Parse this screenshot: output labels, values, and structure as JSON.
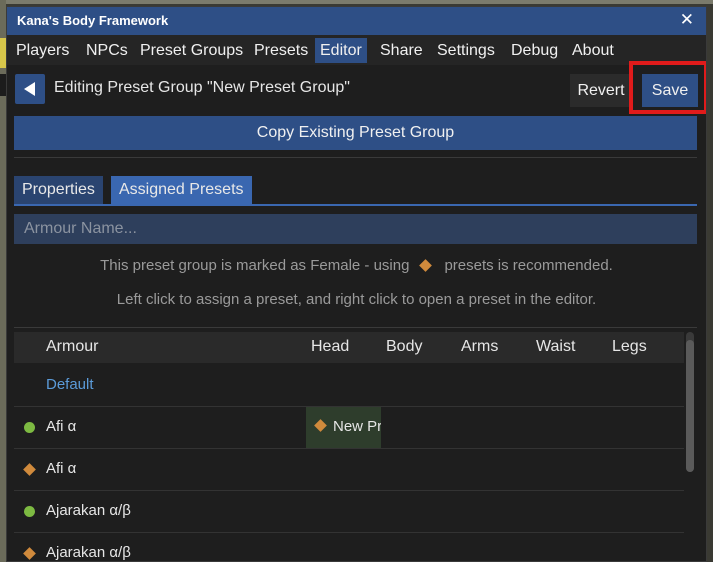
{
  "window": {
    "title": "Kana's Body Framework",
    "close_glyph": "✕"
  },
  "menu": {
    "items": [
      {
        "label": "Players"
      },
      {
        "label": "NPCs"
      },
      {
        "label": "Preset Groups"
      },
      {
        "label": "Presets"
      },
      {
        "label": "Editor",
        "active": true
      },
      {
        "label": "Share"
      },
      {
        "label": "Settings"
      },
      {
        "label": "Debug"
      },
      {
        "label": "About"
      }
    ]
  },
  "editor": {
    "title": "Editing Preset Group \"New Preset Group\"",
    "revert_label": "Revert",
    "save_label": "Save",
    "copy_label": "Copy Existing Preset Group"
  },
  "tabs": [
    {
      "label": "Properties",
      "active": false
    },
    {
      "label": "Assigned Presets",
      "active": true
    }
  ],
  "search": {
    "placeholder": "Armour Name...",
    "value": ""
  },
  "hints": {
    "line1_before": "This preset group is marked as Female - using",
    "line1_after": "presets is recommended.",
    "line2": "Left click to assign a preset, and right click to open a preset in the editor."
  },
  "table": {
    "columns": [
      "Armour",
      "Head",
      "Body",
      "Arms",
      "Waist",
      "Legs"
    ],
    "rows": [
      {
        "name": "Default",
        "marker": "none",
        "head": ""
      },
      {
        "name": "Afi α",
        "marker": "green-dot",
        "head": "New Pr"
      },
      {
        "name": "Afi α",
        "marker": "orange-diamond",
        "head": ""
      },
      {
        "name": "Ajarakan α/β",
        "marker": "green-dot",
        "head": ""
      },
      {
        "name": "Ajarakan α/β",
        "marker": "orange-diamond",
        "head": ""
      }
    ]
  },
  "colors": {
    "accent": "#2e4f86",
    "highlight_box": "#e01b1b",
    "female_marker": "#d08a3c",
    "male_marker": "#7dba42",
    "link": "#5b9bd9"
  }
}
